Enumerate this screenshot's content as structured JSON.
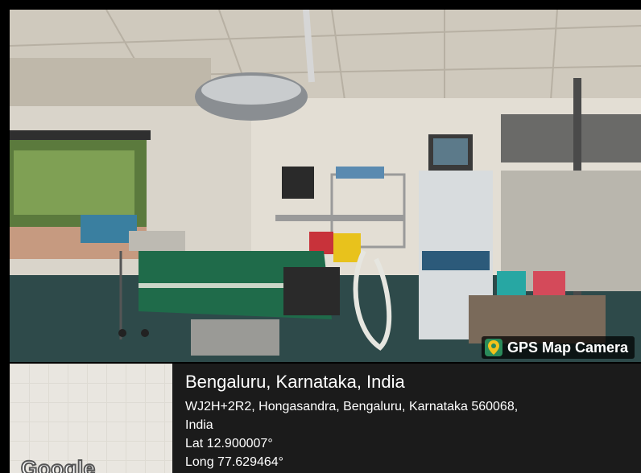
{
  "badge": {
    "label": "GPS Map Camera",
    "icon": "map-pin-icon"
  },
  "location": {
    "city": "Bengaluru, Karnataka, India",
    "address_line1": "WJ2H+2R2, Hongasandra, Bengaluru, Karnataka 560068,",
    "address_line2": "India",
    "lat": "Lat 12.900007°",
    "long": "Long 77.629464°"
  },
  "map": {
    "logo": "Google"
  },
  "colors": {
    "info_bg": "#1b1b1b",
    "drape_green": "#1f6b4a",
    "bucket_red": "#c8323a",
    "bucket_yellow": "#e8c21c",
    "bucket_teal": "#27a7a3"
  }
}
